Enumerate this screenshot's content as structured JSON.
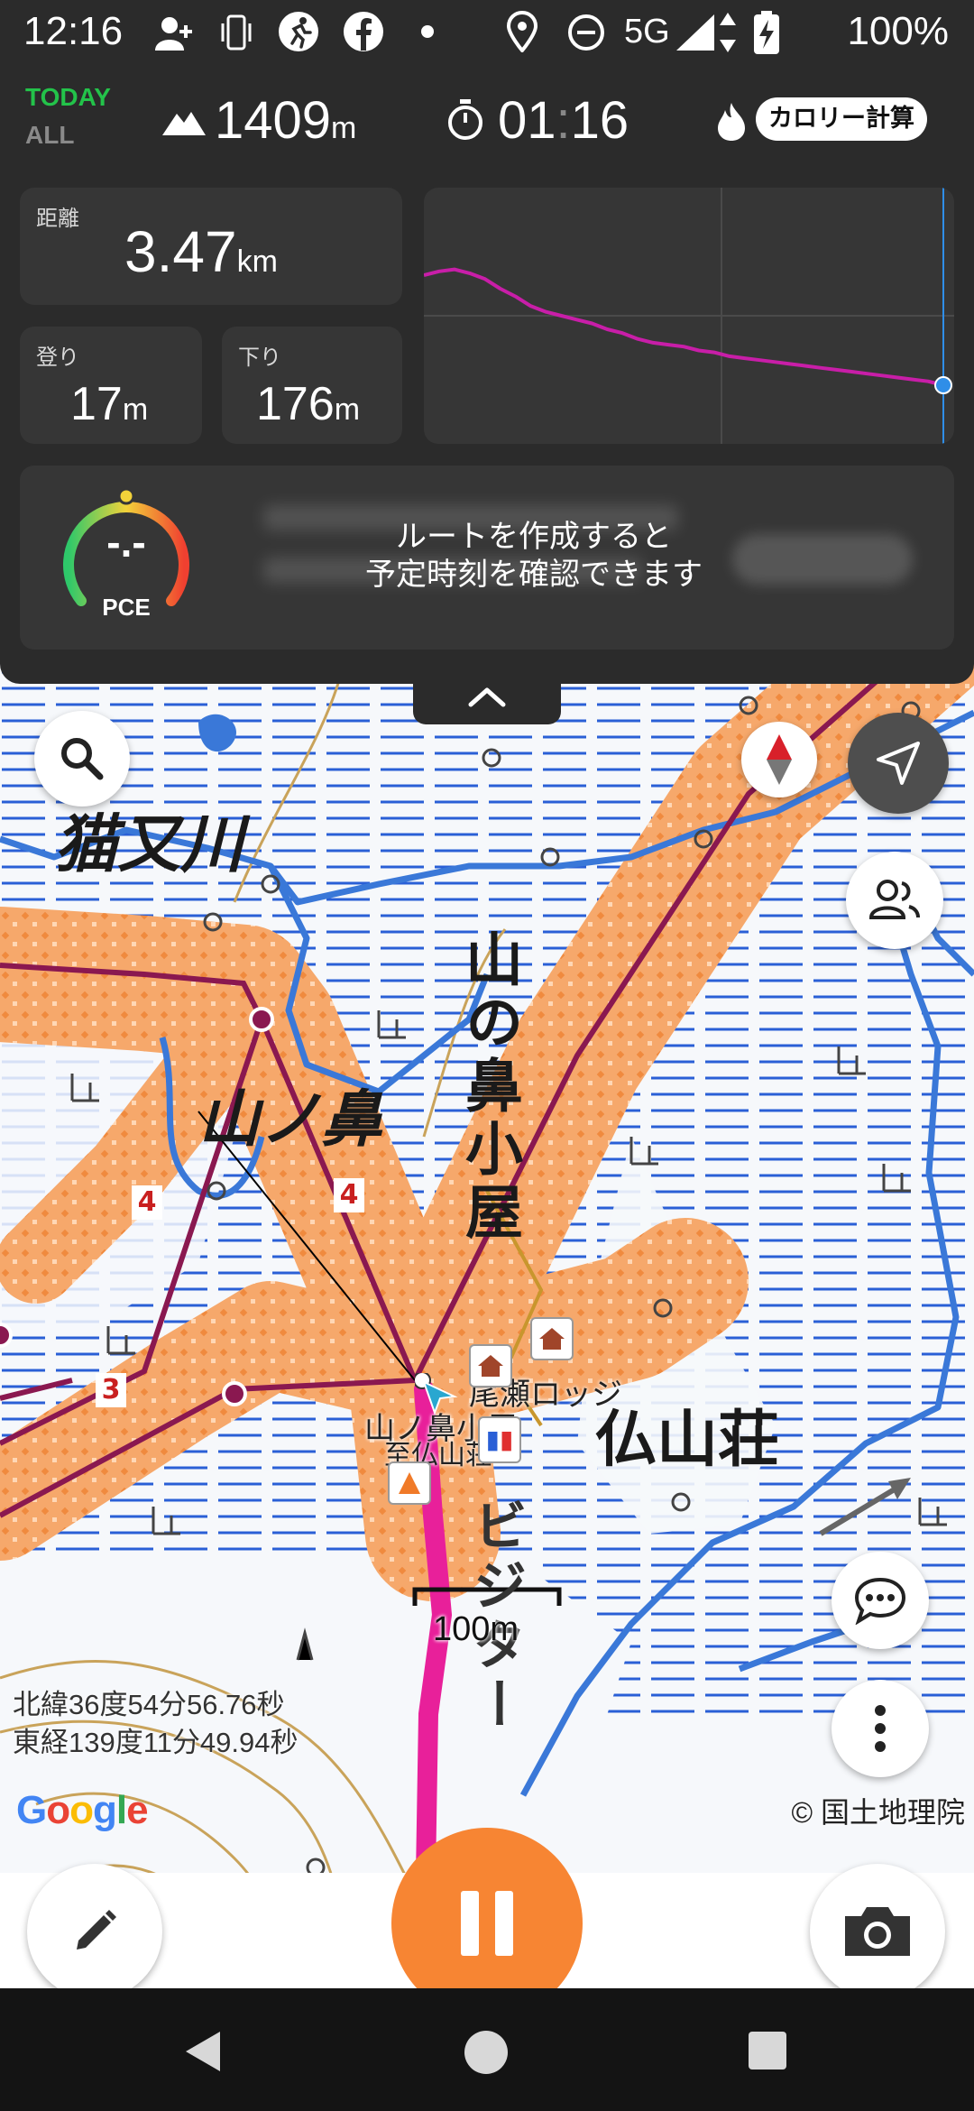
{
  "status_bar": {
    "time": "12:16",
    "network": "5G",
    "battery": "100%",
    "icons": [
      "add-contact-icon",
      "phone-vibrate-icon",
      "running-icon",
      "facebook-icon",
      "dot-icon",
      "location-pin-icon",
      "do-not-disturb-icon",
      "signal-icon",
      "data-arrows-icon",
      "battery-charging-icon"
    ]
  },
  "header": {
    "today_label": "TODAY",
    "all_label": "ALL",
    "altitude_value": "1409",
    "altitude_unit": "m",
    "elapsed_time_hours": "01",
    "elapsed_time_sep": ":",
    "elapsed_time_minutes": "16",
    "calorie_button_label": "カロリー計算",
    "accent_color": "#23c34a"
  },
  "stats": {
    "distance_label": "距離",
    "distance_value": "3.47",
    "distance_unit": "km",
    "ascent_label": "登り",
    "ascent_value": "17",
    "ascent_unit": "m",
    "descent_label": "下り",
    "descent_value": "176",
    "descent_unit": "m"
  },
  "elevation_profile": {
    "line_color": "#c81ea8",
    "marker_color": "#2f8ee8",
    "profile": [
      0.36,
      0.34,
      0.33,
      0.35,
      0.38,
      0.43,
      0.47,
      0.52,
      0.55,
      0.57,
      0.59,
      0.61,
      0.64,
      0.66,
      0.69,
      0.71,
      0.72,
      0.73,
      0.75,
      0.76,
      0.78,
      0.79,
      0.8,
      0.81,
      0.82,
      0.83,
      0.84,
      0.85,
      0.86,
      0.87,
      0.88,
      0.89,
      0.9,
      0.91,
      0.93
    ]
  },
  "pace": {
    "gauge_value": "-.-",
    "gauge_label": "PCE",
    "route_hint_line1": "ルートを作成すると",
    "route_hint_line2": "予定時刻を確認できます"
  },
  "map": {
    "labels": {
      "river": "猫又川",
      "mountain": "山ノ鼻",
      "hut_vertical": "山の鼻小屋",
      "hut_right": "仏山荘",
      "visitor_center_vertical": "ビジター",
      "lodge": "尾瀬ロッジ",
      "hut_poi": "山ノ鼻小屋",
      "hut_poi2": "至仏山荘"
    },
    "trail_numbers": [
      "4",
      "4",
      "3"
    ],
    "scale_label": "100m",
    "latitude": "北緯36度54分56.76秒",
    "longitude": "東経139度11分49.94秒",
    "google_logo": "Google",
    "attribution": "© 国土地理院",
    "colors": {
      "river": "#3a78d8",
      "marsh": "#2a5fd6",
      "track": "#f4a060",
      "trail": "#8a1850",
      "route": "#e8209a",
      "contour": "#c9a35a",
      "control": "#f78533"
    }
  },
  "controls": {
    "search_icon": "search-icon",
    "compass_icon": "compass-icon",
    "locate_icon": "navigation-arrow-icon",
    "people_icon": "people-icon",
    "chat_icon": "chat-bubble-icon",
    "more_icon": "more-vertical-icon",
    "edit_icon": "pencil-icon",
    "pause_icon": "pause-icon",
    "camera_icon": "camera-icon",
    "collapse_icon": "chevron-up-icon"
  },
  "nav_bar": {
    "icons": [
      "back-icon",
      "home-icon",
      "recents-icon"
    ]
  }
}
